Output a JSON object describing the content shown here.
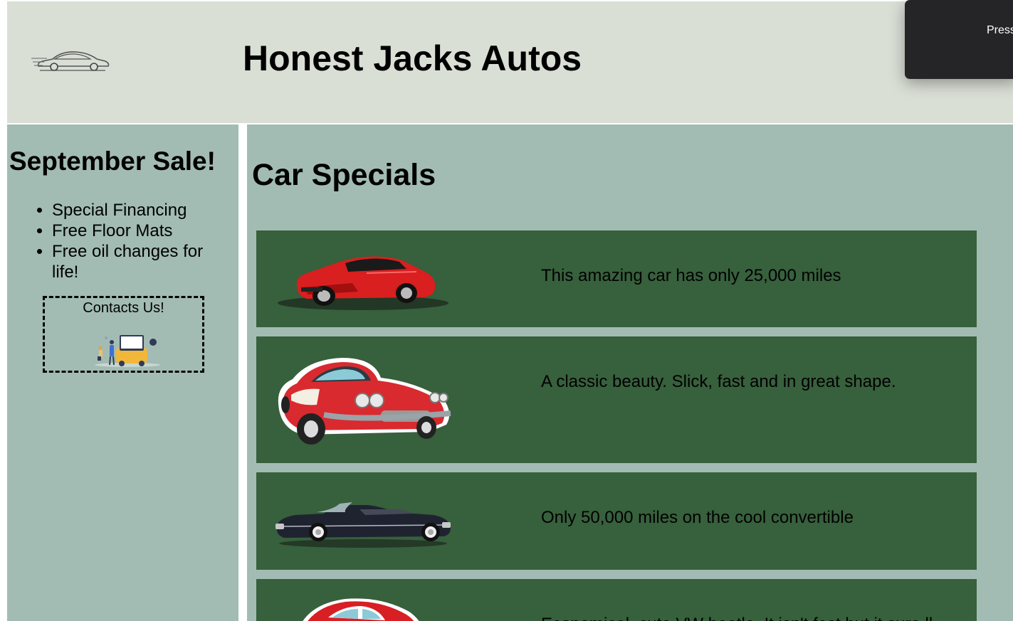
{
  "header": {
    "site_title": "Honest Jacks Autos",
    "logo_icon": "sports-car-sketch-icon"
  },
  "toast": {
    "text": "Press"
  },
  "sidebar": {
    "heading": "September Sale!",
    "items": [
      {
        "label": "Special Financing"
      },
      {
        "label": "Free Floor Mats"
      },
      {
        "label": "Free oil changes for life!"
      }
    ],
    "contact": {
      "label": "Contacts Us!",
      "image_icon": "car-dealer-illustration-icon"
    }
  },
  "main": {
    "heading": "Car Specials",
    "cards": [
      {
        "text": "This amazing car has only 25,000 miles",
        "image": "red-sports-car-icon"
      },
      {
        "text": "A classic beauty. Slick, fast and in great shape.",
        "image": "red-classic-corvette-icon"
      },
      {
        "text": "Only 50,000 miles on the cool convertible",
        "image": "black-convertible-icon"
      },
      {
        "text": "Economical, cute VW beetle. It isn't fast but it sure ll",
        "image": "red-beetle-icon"
      }
    ]
  },
  "colors": {
    "header_bg": "#dadfd6",
    "panel_bg": "#a2bcb4",
    "card_bg": "#37603c",
    "toast_bg": "#252527"
  }
}
